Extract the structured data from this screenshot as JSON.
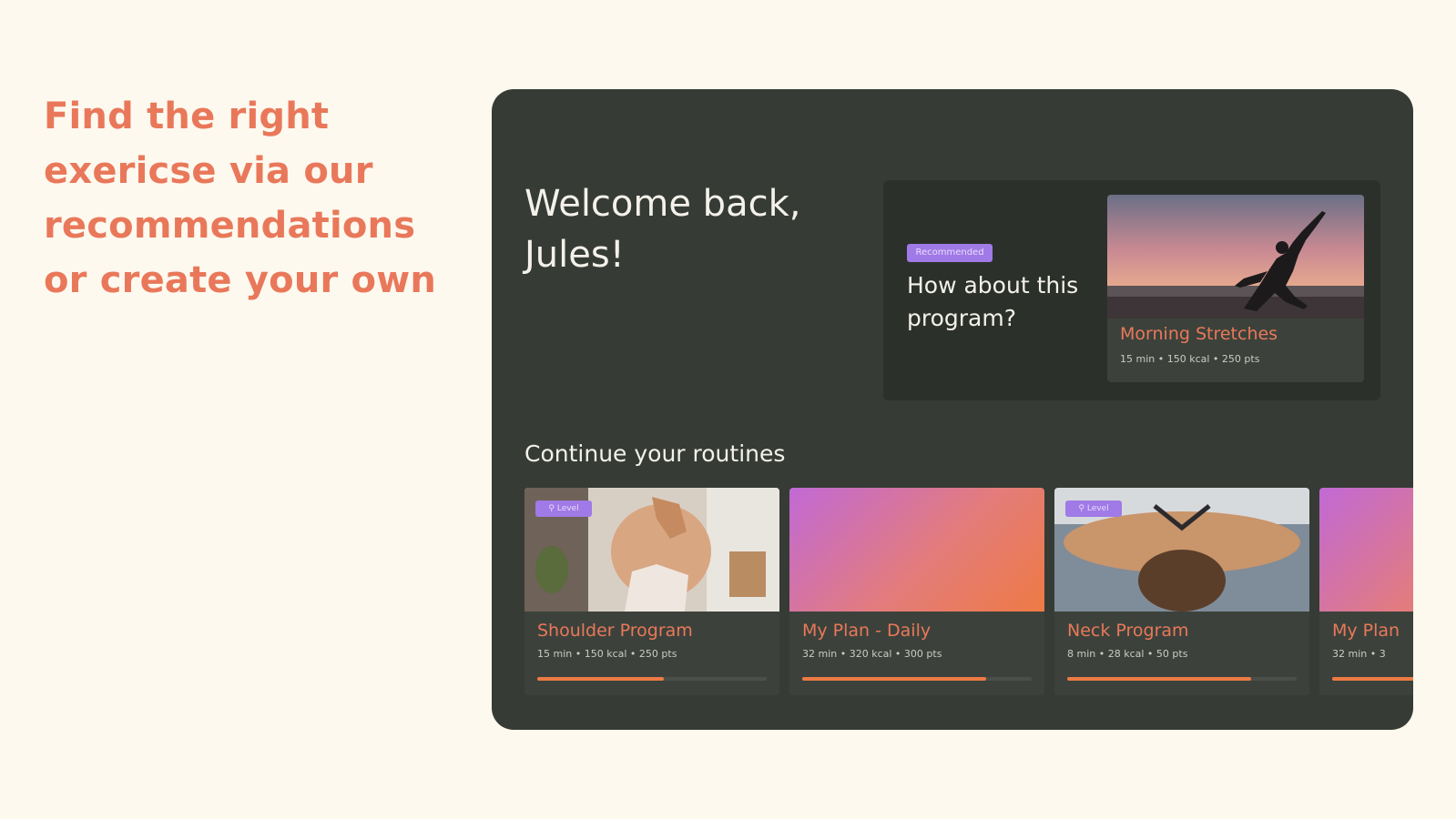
{
  "headline": "Find the right exericse via our recommendations or create your own",
  "welcome": "Welcome back, Jules!",
  "recommendation": {
    "badge": "Recommended",
    "question": "How about this program?",
    "card": {
      "title": "Morning Stretches",
      "meta": "15 min • 150 kcal • 250 pts"
    }
  },
  "routines_title": "Continue your routines",
  "routines": [
    {
      "tag": "⚲ Level",
      "title": "Shoulder Program",
      "meta": "15 min • 150 kcal • 250 pts",
      "progress": 0.55
    },
    {
      "title": "My Plan - Daily",
      "meta": "32 min • 320 kcal • 300 pts",
      "progress": 0.8
    },
    {
      "tag": "⚲ Level",
      "title": "Neck Program",
      "meta": "8 min • 28 kcal • 50 pts",
      "progress": 0.8
    },
    {
      "title": "My Plan",
      "meta": "32 min • 3",
      "progress": 0.8
    }
  ],
  "colors": {
    "accent": "#e9785a",
    "panel": "#363c35",
    "badge": "#a07ae6",
    "background": "#fdf9ef"
  }
}
